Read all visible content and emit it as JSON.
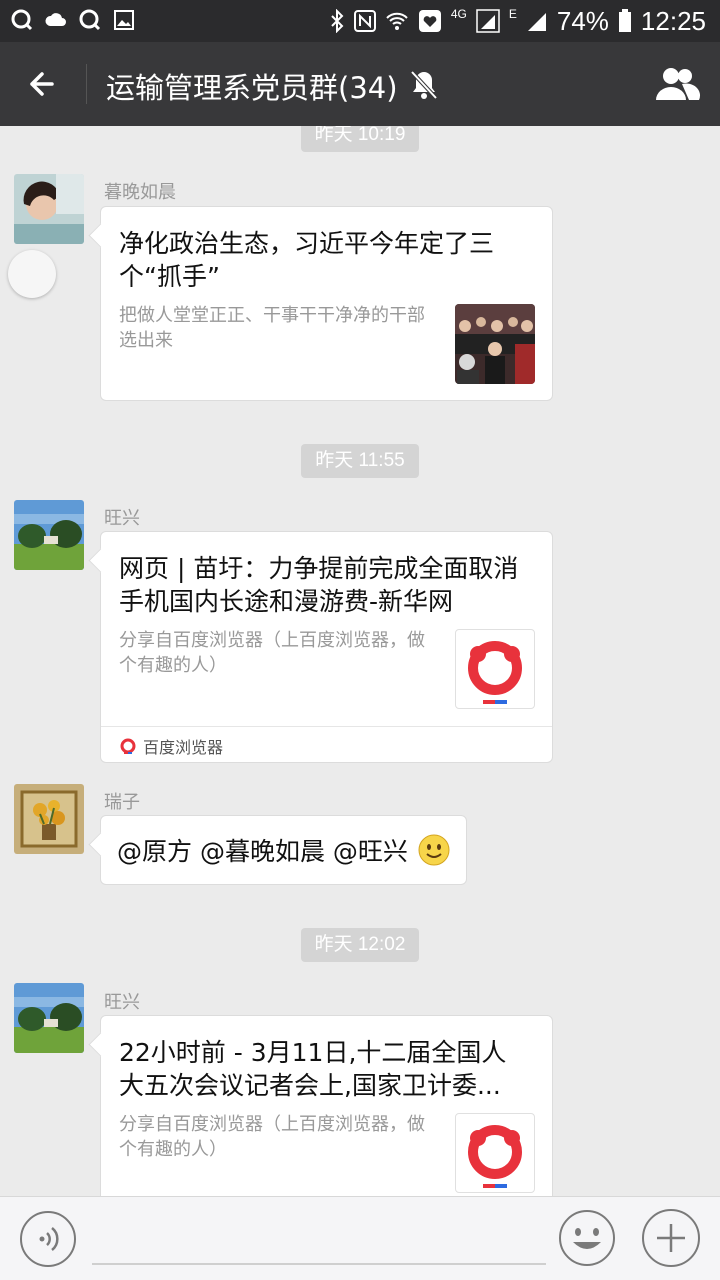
{
  "status_bar": {
    "battery": "74%",
    "time": "12:25",
    "network_4g": "4G",
    "network_e": "E"
  },
  "header": {
    "title": "运输管理系党员群(34)"
  },
  "messages": [
    {
      "time": "昨天 10:19",
      "sender": "暮晚如晨",
      "title": "净化政治生态，习近平今年定了三个“抓手”",
      "desc": "把做人堂堂正正、干事干干净净的干部选出来"
    },
    {
      "time": "昨天 11:55",
      "sender": "旺兴",
      "title": "网页 | 苗圩：力争提前完成全面取消手机国内长途和漫游费-新华网",
      "desc": "分享自百度浏览器（上百度浏览器，做个有趣的人）",
      "source": "百度浏览器"
    },
    {
      "sender": "瑞子",
      "text": "@原方 @暮晚如晨 @旺兴"
    },
    {
      "time": "昨天 12:02",
      "sender": "旺兴",
      "title": "22小时前 - 3月11日,十二届全国人大五次会议记者会上,国家卫计委...",
      "desc": "分享自百度浏览器（上百度浏览器，做个有趣的人）"
    }
  ],
  "colors": {
    "header_bg": "#38383a",
    "chat_bg": "#ebebeb",
    "baidu_red": "#e8323c"
  }
}
